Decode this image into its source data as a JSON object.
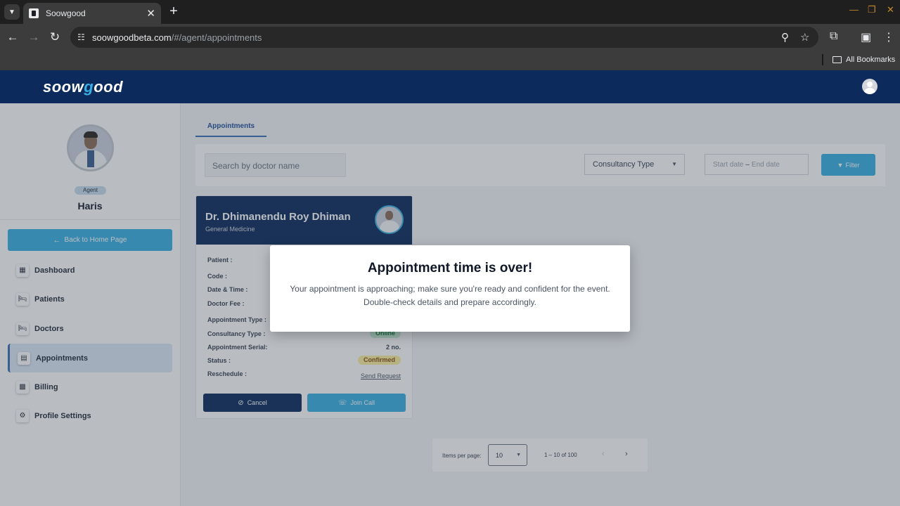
{
  "browser": {
    "tab_title": "Soowgood",
    "tab_close": "✕",
    "new_tab": "+",
    "url_host": "soowgoodbeta.com",
    "url_path": "/#/agent/appointments",
    "bookmarks_label": "All Bookmarks"
  },
  "header": {
    "logo_pre": "soow",
    "logo_g": "g",
    "logo_post": "ood"
  },
  "profile": {
    "role": "Agent",
    "name": "Haris"
  },
  "sidebar": {
    "back_label": "Back to Home Page",
    "items": [
      {
        "label": "Dashboard",
        "icon": "dashboard-grid-icon"
      },
      {
        "label": "Patients",
        "icon": "bed-icon"
      },
      {
        "label": "Doctors",
        "icon": "bed-icon"
      },
      {
        "label": "Appointments",
        "icon": "calendar-icon"
      },
      {
        "label": "Billing",
        "icon": "billing-icon"
      },
      {
        "label": "Profile Settings",
        "icon": "gear-icon"
      }
    ]
  },
  "main": {
    "tab_label": "Appointments",
    "search_placeholder": "Search by doctor name",
    "consultancy_select": "Consultancy Type",
    "start_date_placeholder": "Start date",
    "end_date_placeholder": "End date",
    "date_separator": "–",
    "filter_label": "Filter"
  },
  "appointment": {
    "doctor_name": "Dr. Dhimanendu Roy Dhiman",
    "specialty": "General Medicine",
    "labels": {
      "patient": "Patient :",
      "code": "Code :",
      "datetime": "Date & Time :",
      "fee": "Doctor Fee :",
      "appt_type": "Appointment Type :",
      "consult_type": "Consultancy Type :",
      "serial": "Appointment Serial:",
      "status": "Status :",
      "reschedule": "Reschedule :"
    },
    "consult_type_value": "Online",
    "serial_value": "2 no.",
    "status_value": "Confirmed",
    "reschedule_link": "Send Request",
    "cancel_label": "Cancel",
    "join_label": "Join Call"
  },
  "pagination": {
    "items_per_page_label": "Items per page:",
    "page_size": "10",
    "range": "1 – 10 of 100"
  },
  "modal": {
    "title": "Appointment time is over!",
    "line1": "Your appointment is approaching; make sure you're ready and confident for the event.",
    "line2": "Double-check details and prepare accordingly."
  },
  "colors": {
    "brand_navy": "#0c2a5c",
    "accent_blue": "#3ab0e2",
    "status_confirmed": "#fcef9c",
    "status_online": "#c8f1d9"
  }
}
